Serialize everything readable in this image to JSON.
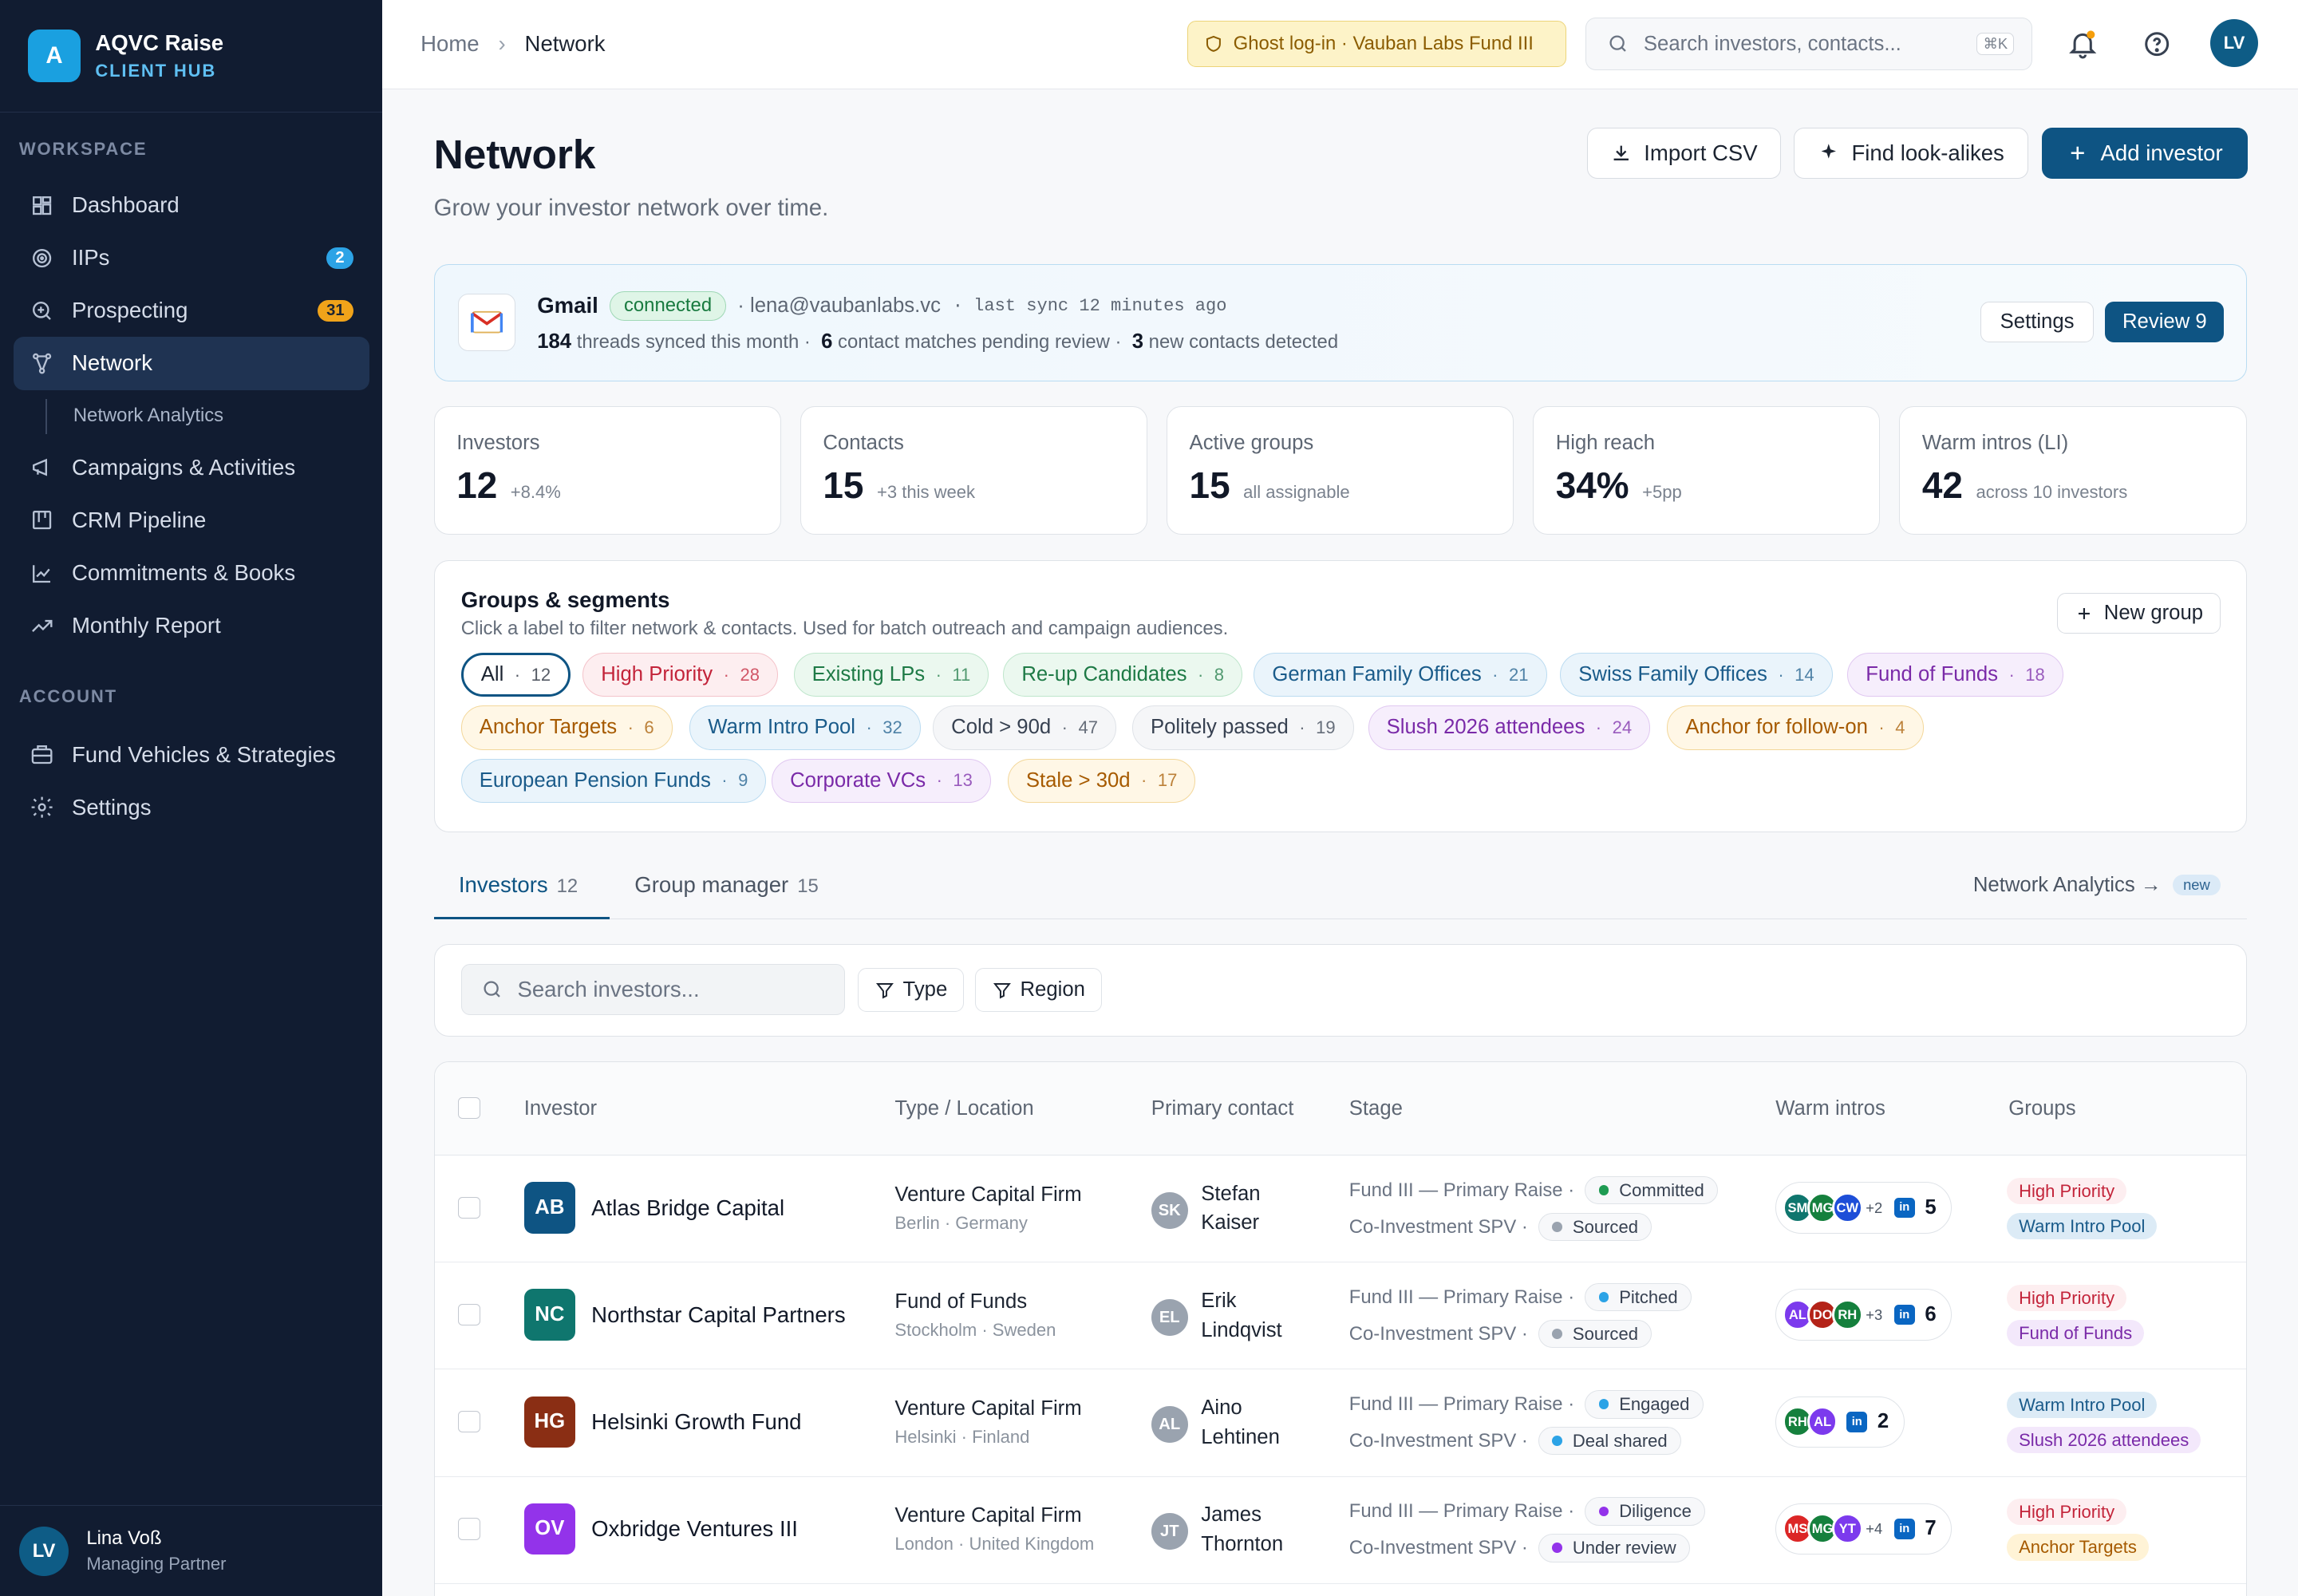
{
  "brand": {
    "initial": "A",
    "name": "AQVC Raise",
    "sub": "CLIENT HUB"
  },
  "sidebar": {
    "workspace_label": "WORKSPACE",
    "account_label": "ACCOUNT",
    "items": [
      {
        "label": "Dashboard",
        "icon": "dashboard-icon"
      },
      {
        "label": "IIPs",
        "icon": "target-icon",
        "badge": "2",
        "badge_color": "#2ca3e6"
      },
      {
        "label": "Prospecting",
        "icon": "search-plus-icon",
        "badge": "31",
        "badge_color": "#f0a31a"
      },
      {
        "label": "Network",
        "icon": "network-icon",
        "active": true
      },
      {
        "label": "Campaigns & Activities",
        "icon": "megaphone-icon"
      },
      {
        "label": "CRM Pipeline",
        "icon": "kanban-icon"
      },
      {
        "label": "Commitments & Books",
        "icon": "chart-line-icon"
      },
      {
        "label": "Monthly Report",
        "icon": "trend-icon"
      }
    ],
    "sub_item": "Network Analytics",
    "account_items": [
      {
        "label": "Fund Vehicles & Strategies",
        "icon": "briefcase-icon"
      },
      {
        "label": "Settings",
        "icon": "gear-icon"
      }
    ],
    "user": {
      "initials": "LV",
      "name": "Lina Voß",
      "role": "Managing Partner"
    }
  },
  "topbar": {
    "crumb_home": "Home",
    "crumb_current": "Network",
    "ghost": "Ghost log-in · Vauban Labs Fund III",
    "search_placeholder": "Search investors, contacts...",
    "kbd": "⌘K",
    "avatar": "LV"
  },
  "page": {
    "title": "Network",
    "subtitle": "Grow your investor network over time.",
    "import": "Import CSV",
    "lookalike": "Find look-alikes",
    "add": "Add investor"
  },
  "gmail": {
    "name": "Gmail",
    "status": "connected",
    "email": "· lena@vaubanlabs.vc",
    "sync": "· last sync 12 minutes ago",
    "threads": "184",
    "threads_label": "threads synced this month ·",
    "matches": "6",
    "matches_label": "contact matches pending review ·",
    "new_contacts": "3",
    "new_label": "new contacts detected",
    "settings": "Settings",
    "review": "Review 9"
  },
  "stats": [
    {
      "label": "Investors",
      "value": "12",
      "note": "+8.4%"
    },
    {
      "label": "Contacts",
      "value": "15",
      "note": "+3 this week"
    },
    {
      "label": "Active groups",
      "value": "15",
      "note": "all assignable"
    },
    {
      "label": "High reach",
      "value": "34%",
      "note": "+5pp"
    },
    {
      "label": "Warm intros (LI)",
      "value": "42",
      "note": "across 10 investors"
    }
  ],
  "groups": {
    "title": "Groups & segments",
    "subtitle": "Click a label to filter network & contacts. Used for batch outreach and campaign audiences.",
    "new_button": "New group",
    "chips": [
      {
        "label": "All",
        "count": "12",
        "color": "#1c2431",
        "bg": "#ffffff",
        "border": "#0e5483"
      },
      {
        "label": "High Priority",
        "count": "28",
        "color": "#c3243a",
        "bg": "#fdeef0",
        "border": "#f4c3ca"
      },
      {
        "label": "Existing LPs",
        "count": "11",
        "color": "#1e7a46",
        "bg": "#ebf8ef",
        "border": "#bfe6cc"
      },
      {
        "label": "Re-up Candidates",
        "count": "8",
        "color": "#1e7a46",
        "bg": "#ebf8ef",
        "border": "#bfe6cc"
      },
      {
        "label": "German Family Offices",
        "count": "21",
        "color": "#1a5b8a",
        "bg": "#eaf4fb",
        "border": "#bcdcf1"
      },
      {
        "label": "Swiss Family Offices",
        "count": "14",
        "color": "#1a5b8a",
        "bg": "#eaf4fb",
        "border": "#bcdcf1"
      },
      {
        "label": "Fund of Funds",
        "count": "18",
        "color": "#7a2aa8",
        "bg": "#f6eefc",
        "border": "#e0c8f1"
      },
      {
        "label": "Anchor Targets",
        "count": "6",
        "color": "#a65a00",
        "bg": "#fff7e6",
        "border": "#f3d79a"
      },
      {
        "label": "Warm Intro Pool",
        "count": "32",
        "color": "#1a5b8a",
        "bg": "#eaf4fb",
        "border": "#bcdcf1"
      },
      {
        "label": "Cold > 90d",
        "count": "47",
        "color": "#374151",
        "bg": "#f5f6f8",
        "border": "#dfe3e8"
      },
      {
        "label": "Politely passed",
        "count": "19",
        "color": "#374151",
        "bg": "#f5f6f8",
        "border": "#dfe3e8"
      },
      {
        "label": "Slush 2026 attendees",
        "count": "24",
        "color": "#7a2aa8",
        "bg": "#f6eefc",
        "border": "#e0c8f1"
      },
      {
        "label": "Anchor for follow-on",
        "count": "4",
        "color": "#a65a00",
        "bg": "#fff7e6",
        "border": "#f3d79a"
      },
      {
        "label": "European Pension Funds",
        "count": "9",
        "color": "#1a5b8a",
        "bg": "#eaf4fb",
        "border": "#bcdcf1"
      },
      {
        "label": "Corporate VCs",
        "count": "13",
        "color": "#7a2aa8",
        "bg": "#f6eefc",
        "border": "#e0c8f1"
      },
      {
        "label": "Stale > 30d",
        "count": "17",
        "color": "#a65a00",
        "bg": "#fff7e6",
        "border": "#f3d79a"
      }
    ]
  },
  "tabs": {
    "investors": "Investors",
    "investors_count": "12",
    "groups": "Group manager",
    "groups_count": "15",
    "analytics": "Network Analytics →",
    "new": "new"
  },
  "filters": {
    "search_placeholder": "Search investors...",
    "type": "Type",
    "region": "Region"
  },
  "table": {
    "headers": {
      "investor": "Investor",
      "type": "Type / Location",
      "contact": "Primary contact",
      "stage": "Stage",
      "warm": "Warm intros",
      "groups": "Groups"
    },
    "rows": [
      {
        "initials": "AB",
        "logo": "#0e5483",
        "name": "Atlas Bridge Capital",
        "type": "Venture Capital Firm",
        "loc": "Berlin · Germany",
        "contact_initials": "SK",
        "contact": "Stefan Kaiser",
        "stage1": "Fund III — Primary Raise",
        "s1": "Committed",
        "s1c": "#1e9b52",
        "stage2": "Co-Investment SPV",
        "s2": "Sourced",
        "s2c": "#9aa3af",
        "avatars": [
          {
            "i": "SM",
            "c": "#0f766e"
          },
          {
            "i": "MG",
            "c": "#15803d"
          },
          {
            "i": "CW",
            "c": "#1d4ed8"
          }
        ],
        "plus": "+2",
        "warm": "5",
        "groups": [
          {
            "l": "High Priority",
            "c": "#c3243a",
            "bg": "#fdeef0"
          },
          {
            "l": "Warm Intro Pool",
            "c": "#1a5b8a",
            "bg": "#dcebf6"
          }
        ]
      },
      {
        "initials": "NC",
        "logo": "#0f766e",
        "name": "Northstar Capital Partners",
        "type": "Fund of Funds",
        "loc": "Stockholm · Sweden",
        "contact_initials": "EL",
        "contact": "Erik Lindqvist",
        "stage1": "Fund III — Primary Raise",
        "s1": "Pitched",
        "s1c": "#2ca3e6",
        "stage2": "Co-Investment SPV",
        "s2": "Sourced",
        "s2c": "#9aa3af",
        "avatars": [
          {
            "i": "AL",
            "c": "#7c3aed"
          },
          {
            "i": "DO",
            "c": "#b42318"
          },
          {
            "i": "RH",
            "c": "#15803d"
          }
        ],
        "plus": "+3",
        "warm": "6",
        "groups": [
          {
            "l": "High Priority",
            "c": "#c3243a",
            "bg": "#fdeef0"
          },
          {
            "l": "Fund of Funds",
            "c": "#7a2aa8",
            "bg": "#f3e8fb"
          }
        ]
      },
      {
        "initials": "HG",
        "logo": "#8a2e14",
        "name": "Helsinki Growth Fund",
        "type": "Venture Capital Firm",
        "loc": "Helsinki · Finland",
        "contact_initials": "AL",
        "contact": "Aino Lehtinen",
        "stage1": "Fund III — Primary Raise",
        "s1": "Engaged",
        "s1c": "#2ca3e6",
        "stage2": "Co-Investment SPV",
        "s2": "Deal shared",
        "s2c": "#2ca3e6",
        "avatars": [
          {
            "i": "RH",
            "c": "#15803d"
          },
          {
            "i": "AL",
            "c": "#7c3aed"
          }
        ],
        "plus": "",
        "warm": "2",
        "groups": [
          {
            "l": "Warm Intro Pool",
            "c": "#1a5b8a",
            "bg": "#dcebf6"
          },
          {
            "l": "Slush 2026 attendees",
            "c": "#7a2aa8",
            "bg": "#f3e8fb"
          }
        ]
      },
      {
        "initials": "OV",
        "logo": "#9333ea",
        "name": "Oxbridge Ventures III",
        "type": "Venture Capital Firm",
        "loc": "London · United Kingdom",
        "contact_initials": "JT",
        "contact": "James Thornton",
        "stage1": "Fund III — Primary Raise",
        "s1": "Diligence",
        "s1c": "#9333ea",
        "stage2": "Co-Investment SPV",
        "s2": "Under review",
        "s2c": "#9333ea",
        "avatars": [
          {
            "i": "MS",
            "c": "#dc2626"
          },
          {
            "i": "MG",
            "c": "#15803d"
          },
          {
            "i": "YT",
            "c": "#7c3aed"
          }
        ],
        "plus": "+4",
        "warm": "7",
        "groups": [
          {
            "l": "High Priority",
            "c": "#c3243a",
            "bg": "#fdeef0"
          },
          {
            "l": "Anchor Targets",
            "c": "#a65a00",
            "bg": "#fff3d6"
          }
        ]
      }
    ]
  }
}
